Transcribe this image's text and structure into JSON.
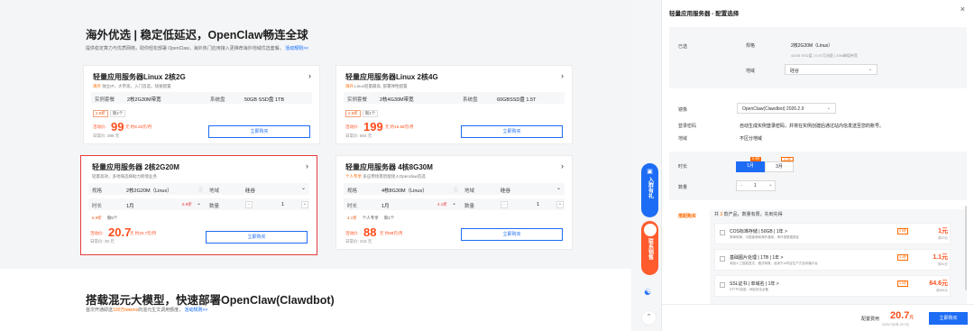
{
  "section1": {
    "title": "海外优选 | 稳定低延迟，OpenClaw畅连全球",
    "subtitle": "提供稳定算力与优质网络，助你轻松部署 OpenClaw，海外热门应用接入更推荐海外地域优选套餐。",
    "link": "活动规则>>"
  },
  "cards": [
    {
      "title": "轻量应用服务器Linux 2核2G",
      "desc_hl": "海外",
      "desc": "独立IP，大带宽，入门首选，快速配置",
      "spec1_label": "实例套餐",
      "spec1_value": "2核2G30M带宽",
      "spec2_label": "系统盘",
      "spec2_value": "50GB SSD盘 1TB",
      "badge1": "2.5折",
      "badge2": "限1个",
      "promo": "活动价:",
      "price": "99",
      "unit": "元 约8.25元/月",
      "orig_label": "日常价:",
      "orig": "396 元",
      "buy": "立即购买"
    },
    {
      "title": "轻量应用服务器Linux 2核4G",
      "desc_hl": "海外",
      "desc": "Linux轻量最高, 部署弹性配置",
      "spec1_label": "实例套餐",
      "spec1_value": "2核4G30M带宽",
      "spec2_label": "系统盘",
      "spec2_value": "60GBSSD盘 1.5T",
      "badge1": "2.5折",
      "badge2": "限1个",
      "promo": "活动价:",
      "price": "199",
      "unit": "元 约16.58元/月",
      "orig_label": "日常价:",
      "orig": "804 元",
      "buy": "立即购买"
    },
    {
      "title": "轻量应用服务器 2核2G20M",
      "desc": "轻量高效，多地域选择助力跨境业务",
      "spec_label": "规格",
      "spec_value": "2核2G20M（Linux）",
      "region_label": "地域",
      "region_value": "硅谷",
      "period_label": "时长",
      "period_value": "1月",
      "period_tag": "6.9折",
      "qty_label": "数量",
      "qty_value": "1",
      "badge1": "6.9折",
      "badge2": "限5个",
      "promo": "活动价:",
      "price": "20.7",
      "unit": "元 约20.7元/月",
      "orig_label": "日常价:",
      "orig": "30 元",
      "buy": "立即购买"
    },
    {
      "title": "轻量应用服务器 4核8G30M",
      "desc_hl": "个人专享",
      "desc": "多应用场景智能接入Openclaw首选",
      "spec_label": "规格",
      "spec_value": "4核8G30M（Linux）",
      "region_label": "地域",
      "region_value": "硅谷",
      "period_label": "时长",
      "period_value": "1月",
      "period_tag": "4.1折",
      "qty_label": "数量",
      "qty_value": "1",
      "badge1": "4.1折",
      "badge2": "个人专享",
      "badge3": "限1个",
      "promo": "活动价:",
      "price": "88",
      "unit": "元 约88元/月",
      "orig_label": "日常价:",
      "orig": "215 元",
      "buy": "立即购买"
    }
  ],
  "section2": {
    "title": "搭载混元大模型，快速部署OpenClaw(Clawdbot)",
    "subtitle_pre": "首次开通即送",
    "subtitle_hl": "100万tokens",
    "subtitle_post": "的混元生文调用额度，",
    "link": "活动规则>>"
  },
  "float": {
    "group": "入群有礼",
    "contact": "联系销售"
  },
  "drawer": {
    "title": "轻量应用服务器 - 配置选择",
    "selected_label": "已选",
    "spec_label": "规格",
    "spec_value": "2核2G20M（Linux）",
    "spec_detail": "40GB SSD盘 | 0.5T月流量 | 20M峰值带宽",
    "region_label": "地域",
    "region_value": "硅谷",
    "image_label": "镜像",
    "image_value": "OpenClaw(Clawdbot) 2026.2.9",
    "login_label": "登录密码",
    "login_value": "自动生成实例登录密码，并将在实例创建后通过站内信发送至您的账号。",
    "zone_label": "地域",
    "zone_value": "不区分地域",
    "period_label": "时长",
    "period_on": "1月",
    "period_off": "3月",
    "period_tag_on": "6.9折",
    "period_tag_off": "4.3折",
    "qty_label": "数量",
    "qty_minus": "−",
    "qty_value": "1",
    "qty_plus": "+",
    "addon_label": "搭配购买",
    "addon_head_pre": "共",
    "addon_head_count": "3",
    "addon_head_post": "款产品，数量有限，先到先得",
    "addons": [
      {
        "name": "COS标准存储 | 50GB | 1年 >",
        "desc": "简单转换、中国香港和海外通用，海外视数据调证",
        "discount": "0.5折",
        "price": "1元",
        "orig": "原20元"
      },
      {
        "name": "基础图片处理 | 1TB | 1年 >",
        "desc": "添加人工智能显式、格式转换，适用于AI内容生产方及传播平台",
        "discount": "0.4折",
        "price": "1.1元",
        "orig": "原30元"
      },
      {
        "name": "SSL证书 | 单域名 | 1年 >",
        "desc": "HTTPS加密，网站安全必备",
        "discount": "0.9折",
        "price": "64.6元",
        "orig": "原689元"
      }
    ],
    "footer_label": "配置费用",
    "footer_price": "20.7",
    "footer_unit": "元",
    "footer_orig": "2025.7元/年 29.7元",
    "footer_button": "立即购买"
  }
}
